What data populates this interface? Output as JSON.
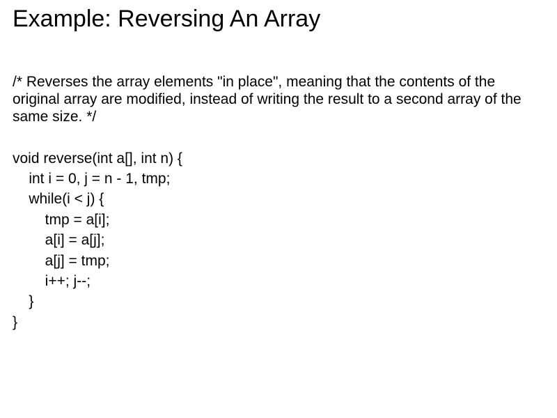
{
  "title": "Example: Reversing An Array",
  "comment": "/* Reverses the array elements \"in place\", meaning that the contents of the original array are modified, instead of writing the result to a second array of the same size. */",
  "code": "void reverse(int a[], int n) {\n    int i = 0, j = n - 1, tmp;\n    while(i < j) {\n        tmp = a[i];\n        a[i] = a[j];\n        a[j] = tmp;\n        i++; j--;\n    }\n}"
}
